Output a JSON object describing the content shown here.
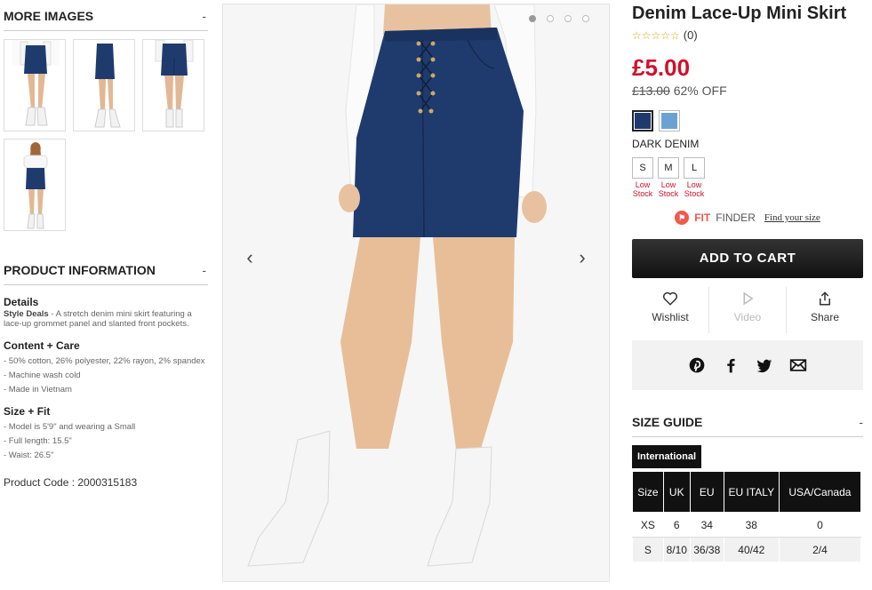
{
  "left": {
    "more_images": {
      "title": "MORE IMAGES",
      "toggle": "-"
    },
    "product_info": {
      "title": "PRODUCT INFORMATION",
      "toggle": "-",
      "details_heading": "Details",
      "details_brand": "Style Deals",
      "details_text": " - A stretch denim mini skirt featuring a lace-up grommet panel and slanted front pockets.",
      "content_heading": "Content + Care",
      "content_lines": [
        "- 50% cotton, 26% polyester, 22% rayon, 2% spandex",
        "- Machine wash cold",
        "- Made in Vietnam"
      ],
      "size_heading": "Size + Fit",
      "size_lines": [
        "- Model is 5'9\" and wearing a Small",
        "- Full length: 15.5\"",
        "- Waist: 26.5\""
      ],
      "product_code": "Product Code : 2000315183"
    }
  },
  "gallery": {
    "prev_arrow": "‹",
    "next_arrow": "›",
    "active_dot": 0,
    "dot_count": 4
  },
  "product": {
    "title": "Denim Lace-Up Mini Skirt",
    "stars": "☆☆☆☆☆",
    "review_count": "(0)",
    "price": "£5.00",
    "old_price": "£13.00",
    "discount": "62% OFF",
    "swatch_colors": [
      "#1f3b6e",
      "#6aa3d3"
    ],
    "color_name": "DARK DENIM",
    "sizes": [
      {
        "label": "S",
        "stock": "Low Stock"
      },
      {
        "label": "M",
        "stock": "Low Stock"
      },
      {
        "label": "L",
        "stock": "Low Stock"
      }
    ],
    "fit_finder": {
      "brand_a": "FIT",
      "brand_b": "FINDER",
      "link": "Find your size"
    },
    "add_to_cart": "ADD TO CART",
    "actions": {
      "wishlist": "Wishlist",
      "video": "Video",
      "share": "Share"
    },
    "accent_color": "#d0102b"
  },
  "size_guide": {
    "title": "SIZE GUIDE",
    "toggle": "-",
    "tab": "International",
    "headers": [
      "Size",
      "UK",
      "EU",
      "EU ITALY",
      "USA/Canada"
    ],
    "rows": [
      [
        "XS",
        "6",
        "34",
        "38",
        "0"
      ],
      [
        "S",
        "8/10",
        "36/38",
        "40/42",
        "2/4"
      ]
    ]
  }
}
